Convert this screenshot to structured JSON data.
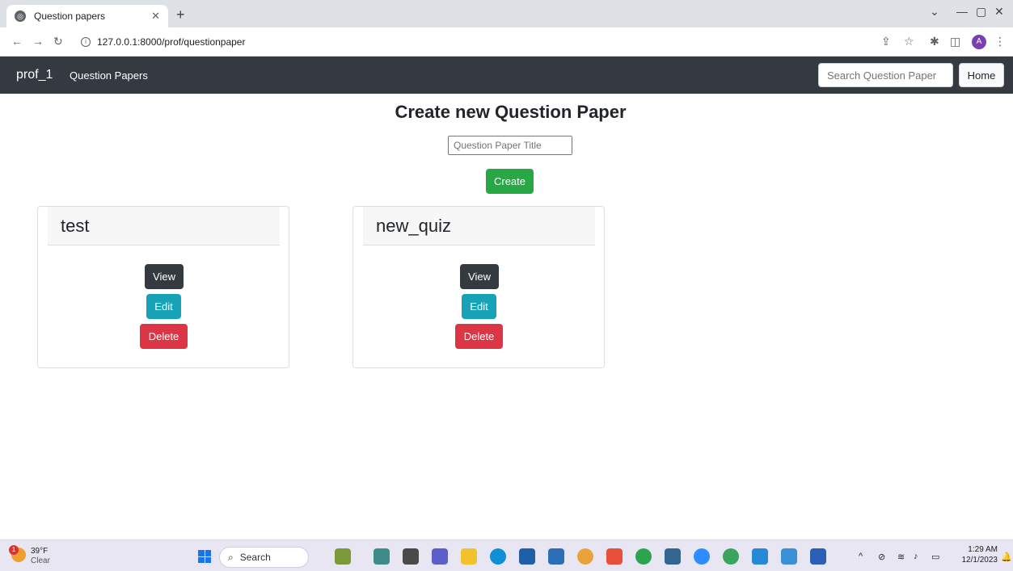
{
  "browser": {
    "tab_title": "Question papers",
    "url": "127.0.0.1:8000/prof/questionpaper",
    "profile_initial": "A"
  },
  "navbar": {
    "brand": "prof_1",
    "link": "Question Papers",
    "search_placeholder": "Search Question Paper",
    "home_label": "Home"
  },
  "main": {
    "heading": "Create new Question Paper",
    "title_placeholder": "Question Paper Title",
    "create_label": "Create"
  },
  "cards": [
    {
      "title": "test",
      "view": "View",
      "edit": "Edit",
      "delete": "Delete"
    },
    {
      "title": "new_quiz",
      "view": "View",
      "edit": "Edit",
      "delete": "Delete"
    }
  ],
  "taskbar": {
    "weather_temp": "39°F",
    "weather_desc": "Clear",
    "weather_badge": "1",
    "search_label": "Search",
    "time": "1:29 AM",
    "date": "12/1/2023"
  },
  "colors": {
    "navbar": "#343a40",
    "create": "#28a745",
    "view": "#343a40",
    "edit": "#17a2b8",
    "delete": "#dc3545"
  }
}
